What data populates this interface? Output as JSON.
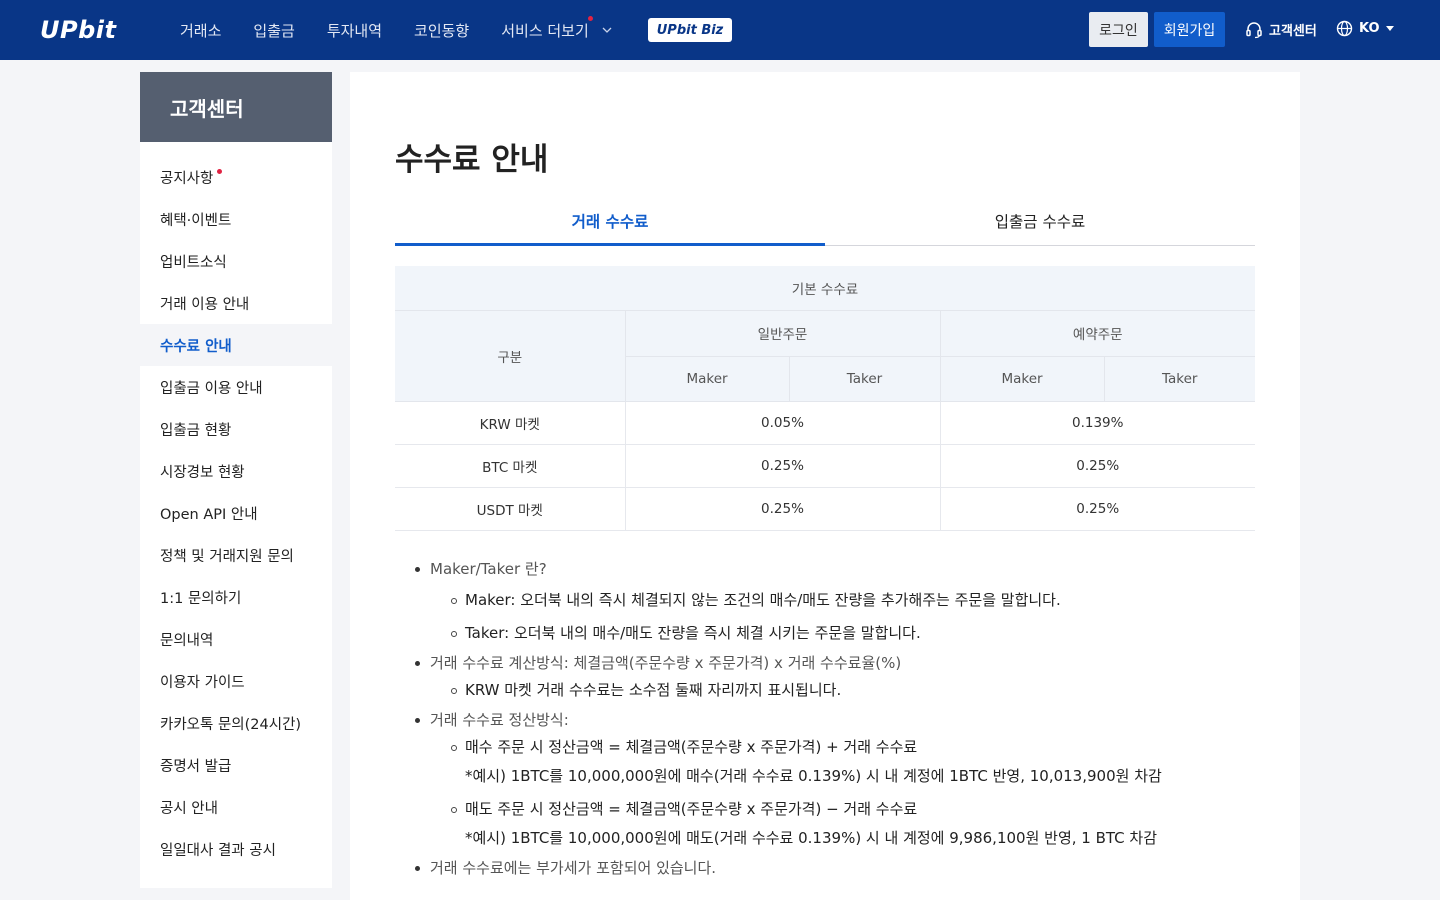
{
  "header": {
    "logo": "UPbit",
    "nav": [
      {
        "label": "거래소"
      },
      {
        "label": "입출금"
      },
      {
        "label": "투자내역"
      },
      {
        "label": "코인동향"
      },
      {
        "label": "서비스 더보기"
      }
    ],
    "biz_badge": "UPbit Biz",
    "login_label": "로그인",
    "join_label": "회원가입",
    "customer_center_label": "고객센터",
    "language": "KO"
  },
  "sidebar": {
    "title": "고객센터",
    "items": [
      {
        "label": "공지사항"
      },
      {
        "label": "혜택·이벤트"
      },
      {
        "label": "업비트소식"
      },
      {
        "label": "거래 이용 안내"
      },
      {
        "label": "수수료 안내"
      },
      {
        "label": "입출금 이용 안내"
      },
      {
        "label": "입출금 현황"
      },
      {
        "label": "시장경보 현황"
      },
      {
        "label": "Open API 안내"
      },
      {
        "label": "정책 및 거래지원 문의"
      },
      {
        "label": "1:1 문의하기"
      },
      {
        "label": "문의내역"
      },
      {
        "label": "이용자 가이드"
      },
      {
        "label": "카카오톡 문의(24시간)"
      },
      {
        "label": "증명서 발급"
      },
      {
        "label": "공시 안내"
      },
      {
        "label": "일일대사 결과 공시"
      }
    ]
  },
  "main": {
    "title": "수수료 안내",
    "tabs": [
      {
        "label": "거래 수수료"
      },
      {
        "label": "입출금 수수료"
      }
    ],
    "table": {
      "header_basic": "기본 수수료",
      "header_category": "구분",
      "header_normal": "일반주문",
      "header_reserved": "예약주문",
      "maker": "Maker",
      "taker": "Taker",
      "rows": [
        {
          "market": "KRW 마켓",
          "normal": "0.05%",
          "reserved": "0.139%"
        },
        {
          "market": "BTC 마켓",
          "normal": "0.25%",
          "reserved": "0.25%"
        },
        {
          "market": "USDT 마켓",
          "normal": "0.25%",
          "reserved": "0.25%"
        }
      ]
    },
    "notes": {
      "n1": "Maker/Taker 란?",
      "n1a": "Maker: 오더북 내의 즉시 체결되지 않는 조건의 매수/매도 잔량을 추가해주는 주문을 말합니다.",
      "n1b": "Taker: 오더북 내의 매수/매도 잔량을 즉시 체결 시키는 주문을 말합니다.",
      "n2": "거래 수수료 계산방식: 체결금액(주문수량 x 주문가격) x 거래 수수료율(%)",
      "n2a": "KRW 마켓 거래 수수료는 소수점 둘째 자리까지 표시됩니다.",
      "n3": "거래 수수료 정산방식:",
      "n3a": "매수 주문 시 정산금액 = 체결금액(주문수량 x 주문가격) + 거래 수수료",
      "n3a_ex": "*예시) 1BTC를 10,000,000원에 매수(거래 수수료 0.139%) 시 내 계정에 1BTC 반영, 10,013,900원 차감",
      "n3b": "매도 주문 시 정산금액 = 체결금액(주문수량 x 주문가격) − 거래 수수료",
      "n3b_ex": "*예시) 1BTC를 10,000,000원에 매도(거래 수수료 0.139%) 시 내 계정에 9,986,100원 반영, 1 BTC 차감",
      "n4": "거래 수수료에는 부가세가 포함되어 있습니다."
    }
  },
  "colors": {
    "header_bg": "#093687",
    "accent": "#115dcb",
    "sidebar_head_bg": "#555f70",
    "notice_dot": "#e12343"
  },
  "icons": {
    "headset": "headset-icon",
    "globe": "globe-icon",
    "chevron": "chevron-down-icon"
  }
}
